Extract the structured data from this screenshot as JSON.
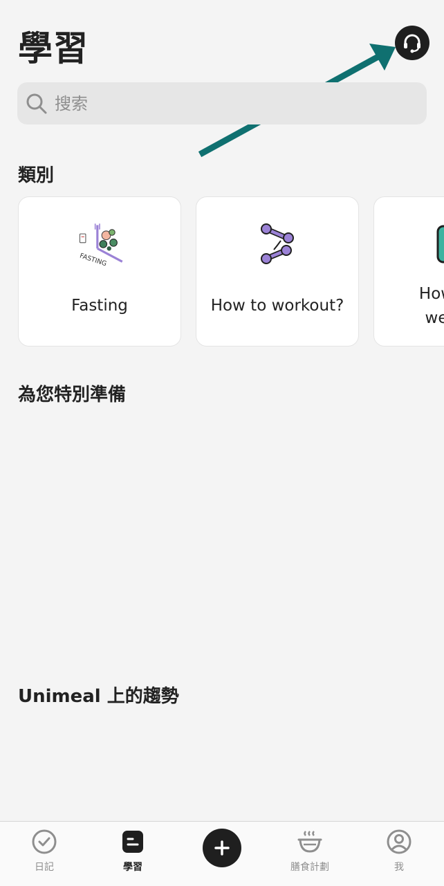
{
  "header": {
    "title": "學習",
    "support_icon": "headset-icon"
  },
  "search": {
    "placeholder": "搜索",
    "icon": "search-icon"
  },
  "sections": {
    "categories_title": "類別",
    "for_you_title": "為您特別準備",
    "trending_title": "Unimeal 上的趨勢"
  },
  "categories": [
    {
      "label": "Fasting",
      "icon_text": "FASTING",
      "icon": "fasting-illustration-icon"
    },
    {
      "label": "How to workout?",
      "icon": "dumbbell-icon"
    },
    {
      "label": "How",
      "label_line2": "we",
      "icon": "scale-icon"
    }
  ],
  "bottom_nav": {
    "items": [
      {
        "label": "日記",
        "icon": "check-circle-icon"
      },
      {
        "label": "學習",
        "icon": "document-icon",
        "active": true
      },
      {
        "label": "",
        "icon": "plus-icon"
      },
      {
        "label": "膳食計劃",
        "icon": "bowl-icon"
      },
      {
        "label": "我",
        "icon": "user-circle-icon"
      }
    ]
  },
  "colors": {
    "accent_arrow": "#0f7070",
    "dark": "#1f1f1f",
    "background": "#f4f4f4",
    "dumbbell": "#9b82d6"
  }
}
